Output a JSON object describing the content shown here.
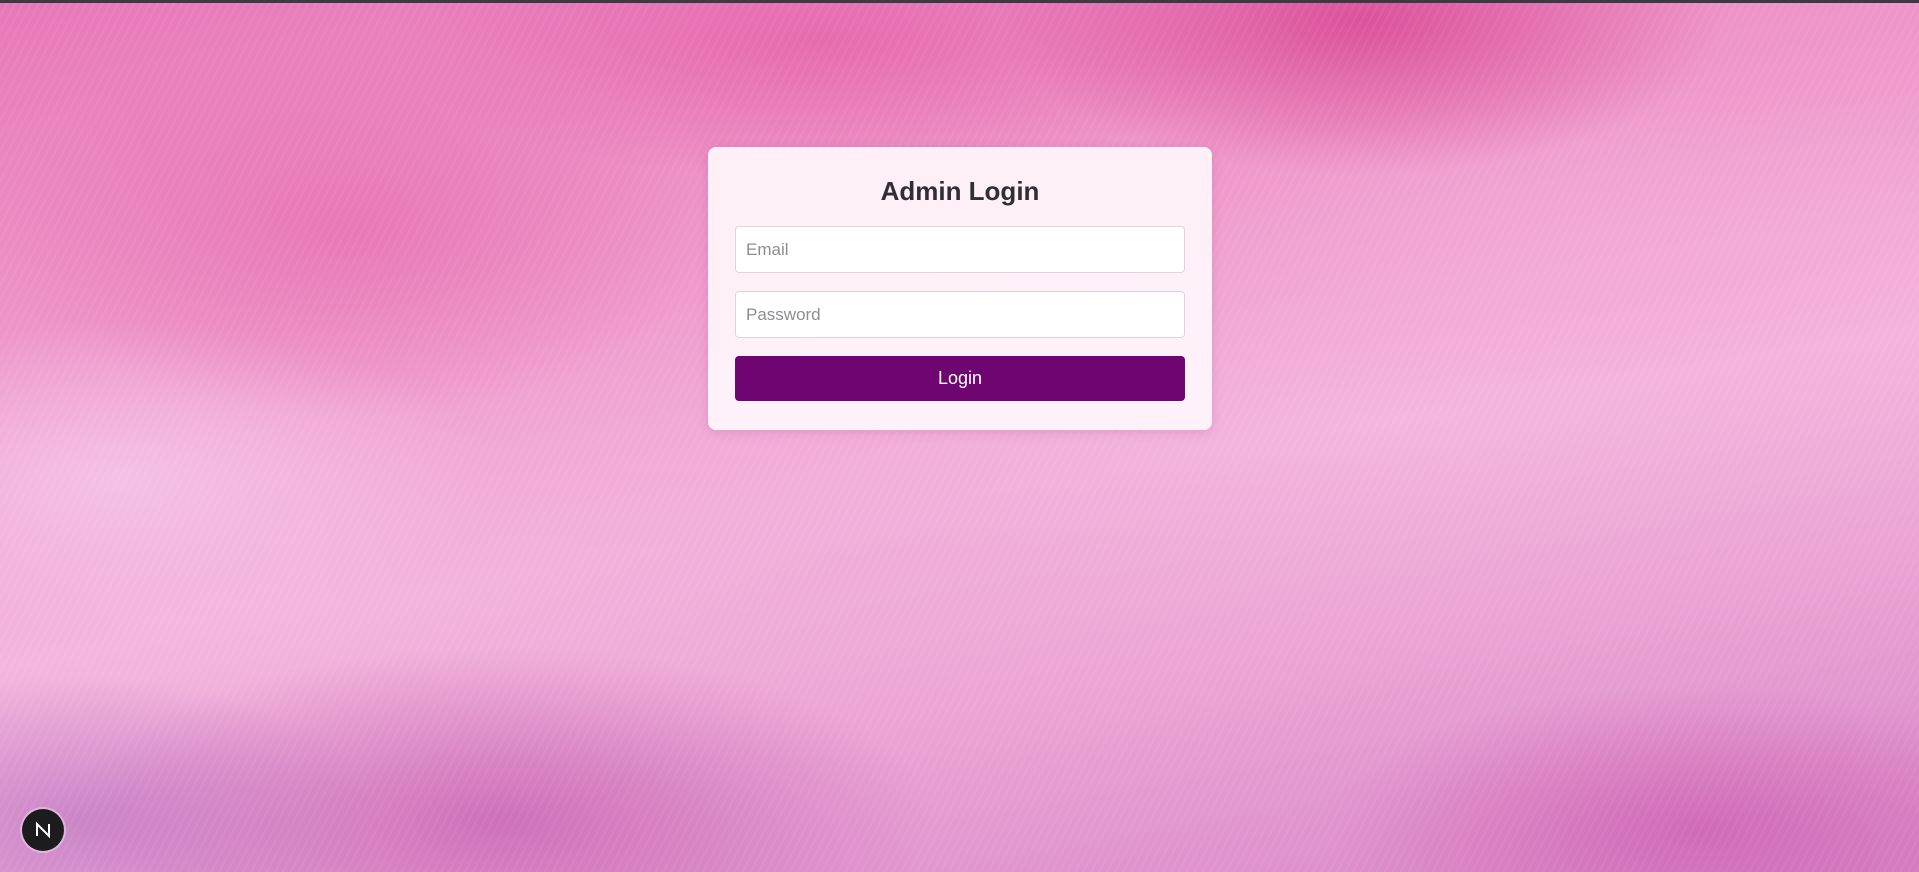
{
  "login": {
    "title": "Admin Login",
    "email_placeholder": "Email",
    "email_value": "",
    "password_placeholder": "Password",
    "password_value": "",
    "submit_label": "Login"
  },
  "dev_badge": {
    "icon": "nextjs-logo-icon",
    "letter": "N"
  },
  "colors": {
    "primary_button": "#6f0570",
    "card_background": "#fff4fa",
    "title_text": "#2f2f35",
    "background_pink": "#ef9ccd"
  }
}
